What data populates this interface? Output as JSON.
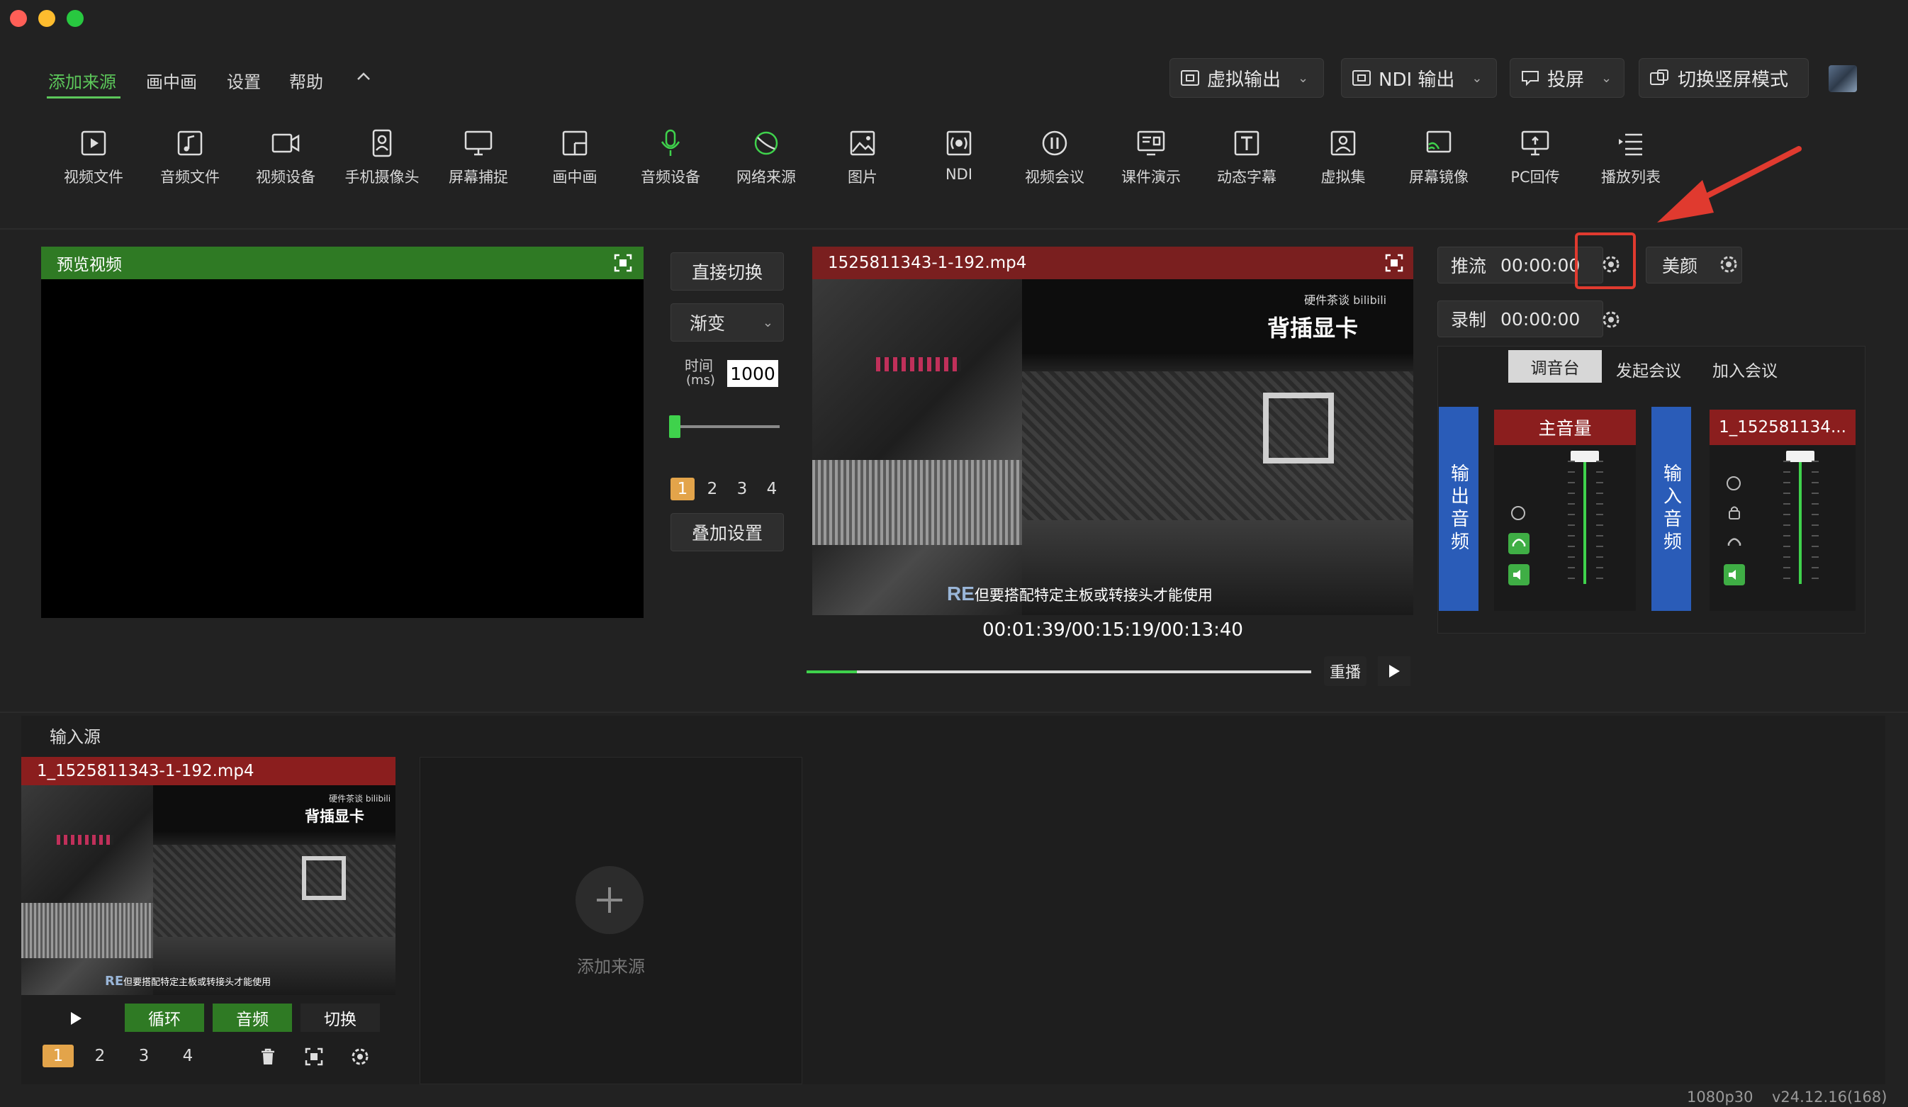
{
  "menu": {
    "tabs": [
      "添加来源",
      "画中画",
      "设置",
      "帮助"
    ],
    "collapse_icon": "chevron-up-icon"
  },
  "top_buttons": {
    "virtual_output": "虚拟输出",
    "ndi_output": "NDI 输出",
    "cast": "投屏",
    "portrait_mode": "切换竖屏模式"
  },
  "toolbar": [
    {
      "label": "视频文件",
      "icon": "video-file-icon"
    },
    {
      "label": "音频文件",
      "icon": "audio-file-icon"
    },
    {
      "label": "视频设备",
      "icon": "video-device-icon"
    },
    {
      "label": "手机摄像头",
      "icon": "phone-camera-icon"
    },
    {
      "label": "屏幕捕捉",
      "icon": "screen-capture-icon"
    },
    {
      "label": "画中画",
      "icon": "pip-icon"
    },
    {
      "label": "音频设备",
      "icon": "microphone-icon"
    },
    {
      "label": "网络来源",
      "icon": "network-source-icon"
    },
    {
      "label": "图片",
      "icon": "image-icon"
    },
    {
      "label": "NDI",
      "icon": "ndi-icon"
    },
    {
      "label": "视频会议",
      "icon": "video-meeting-icon"
    },
    {
      "label": "课件演示",
      "icon": "slides-icon"
    },
    {
      "label": "动态字幕",
      "icon": "text-icon"
    },
    {
      "label": "虚拟集",
      "icon": "virtual-set-icon"
    },
    {
      "label": "屏幕镜像",
      "icon": "screen-mirror-icon"
    },
    {
      "label": "PC回传",
      "icon": "pc-return-icon"
    },
    {
      "label": "播放列表",
      "icon": "playlist-icon"
    }
  ],
  "preview": {
    "title": "预览视频"
  },
  "transition": {
    "direct_cut": "直接切换",
    "mode": "渐变",
    "time_label": "时间",
    "time_unit": "(ms)",
    "time_value": "1000",
    "slider_fraction": 0.04,
    "slots": [
      "1",
      "2",
      "3",
      "4"
    ],
    "active_slot": "1",
    "overlay_settings": "叠加设置"
  },
  "program": {
    "title": "1525811343-1-192.mp4",
    "overlay_brand": "硬件茶谈",
    "overlay_bili": "bilibili",
    "overlay_title": "背插显卡",
    "subtitle": "但要搭配特定主板或转接头才能使用",
    "timecode": "00:01:39/00:15:19/00:13:40",
    "progress_fraction": 0.1,
    "replay_label": "重播"
  },
  "stream": {
    "push_label": "推流",
    "push_time": "00:00:00",
    "beauty_label": "美颜",
    "record_label": "录制",
    "record_time": "00:00:00"
  },
  "mixer": {
    "tabs": [
      "调音台",
      "发起会议",
      "加入会议"
    ],
    "active_tab": "调音台",
    "output_audio": "输出音频",
    "input_audio": "输入音频",
    "master_label": "主音量",
    "channel_label": "1_152581134..."
  },
  "input_sources": {
    "section_title": "输入源",
    "source_title": "1_1525811343-1-192.mp4",
    "overlay_title": "背插显卡",
    "overlay_brand": "硬件茶谈",
    "overlay_bili": "bilibili",
    "subtitle": "但要搭配特定主板或转接头才能使用",
    "loop_label": "循环",
    "audio_label": "音频",
    "switch_label": "切换",
    "slots": [
      "1",
      "2",
      "3",
      "4"
    ],
    "active_slot": "1",
    "add_source_label": "添加来源"
  },
  "status": {
    "resolution": "1080p30",
    "version": "v24.12.16(168)"
  },
  "colors": {
    "accent_green": "#5cc75a",
    "header_green": "#2f7a24",
    "header_red": "#7a1f1f",
    "mixer_blue": "#2a5cb8",
    "highlight_red": "#e03a2f",
    "slot_orange": "#e3a44a"
  }
}
